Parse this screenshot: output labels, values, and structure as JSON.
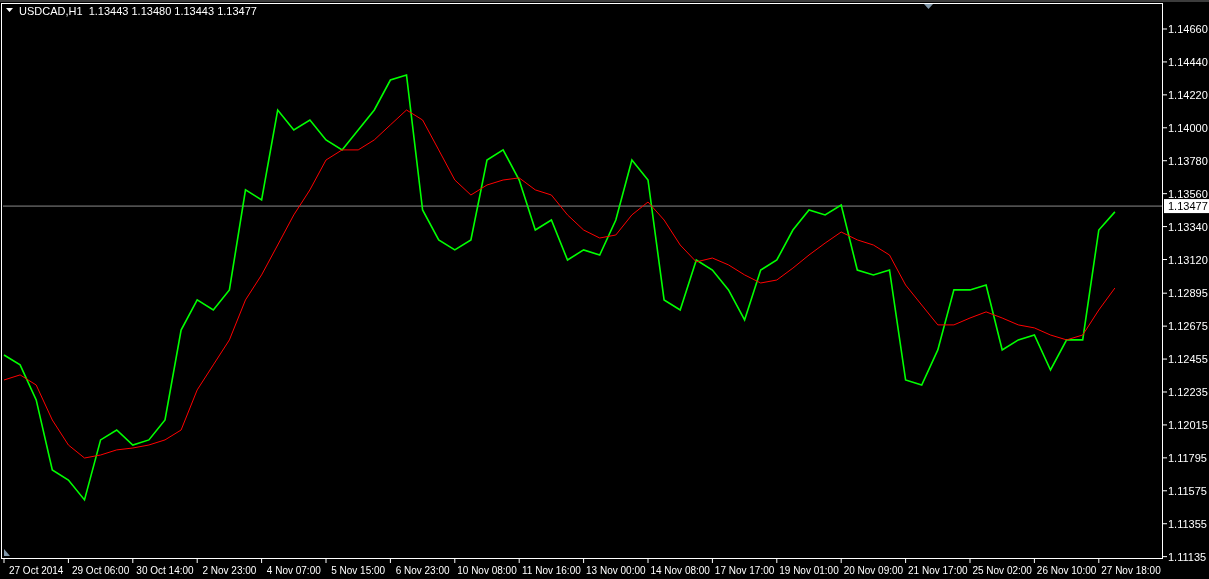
{
  "header": {
    "symbol": "USDCAD,H1",
    "quotes": [
      "1.13443",
      "1.13480",
      "1.13443",
      "1.13477"
    ]
  },
  "chart_data": {
    "type": "line",
    "categories": [
      null,
      null,
      "27 Oct 2014",
      null,
      null,
      null,
      "29 Oct 06:00",
      null,
      null,
      null,
      "30 Oct 14:00",
      null,
      null,
      null,
      "2 Nov 23:00",
      null,
      null,
      null,
      "4 Nov 07:00",
      null,
      null,
      null,
      "5 Nov 15:00",
      null,
      null,
      null,
      "6 Nov 23:00",
      null,
      null,
      null,
      "10 Nov 08:00",
      null,
      null,
      null,
      "11 Nov 16:00",
      null,
      null,
      null,
      "13 Nov 00:00",
      null,
      null,
      null,
      "14 Nov 08:00",
      null,
      null,
      null,
      "17 Nov 17:00",
      null,
      null,
      null,
      "19 Nov 01:00",
      null,
      null,
      null,
      "20 Nov 09:00",
      null,
      null,
      null,
      "21 Nov 17:00",
      null,
      null,
      null,
      "25 Nov 02:00",
      null,
      null,
      null,
      "26 Nov 10:00",
      null,
      null,
      null,
      "27 Nov 18:00"
    ],
    "series": [
      {
        "color": "#00ff00",
        "values": [
          1.12482,
          1.12416,
          1.12182,
          1.11714,
          1.11647,
          1.11514,
          1.11915,
          1.11981,
          1.11881,
          1.11915,
          1.12048,
          1.12649,
          1.1285,
          1.12783,
          1.12917,
          1.13585,
          1.13518,
          1.14119,
          1.13985,
          1.14052,
          1.13919,
          1.13852,
          1.13985,
          1.14119,
          1.14319,
          1.14353,
          1.13451,
          1.13251,
          1.13184,
          1.13251,
          1.13785,
          1.13852,
          1.13651,
          1.13317,
          1.13384,
          1.13117,
          1.13184,
          1.1315,
          1.13384,
          1.13785,
          1.13651,
          1.1285,
          1.12783,
          1.13117,
          1.1305,
          1.12917,
          1.12716,
          1.1305,
          1.13117,
          1.13317,
          1.13451,
          1.13418,
          1.13484,
          1.1305,
          1.13017,
          1.1305,
          1.12315,
          1.12282,
          1.12516,
          1.12917,
          1.12917,
          1.1295,
          1.12516,
          1.12583,
          1.12616,
          1.12382,
          1.12583,
          1.12583,
          1.13317,
          1.13438,
          null
        ]
      },
      {
        "color": "#ff0000",
        "values": [
          1.12315,
          1.12349,
          1.12282,
          1.12048,
          1.11881,
          1.11794,
          1.11814,
          1.11848,
          1.11861,
          1.11881,
          1.11915,
          1.11981,
          1.12249,
          1.12416,
          1.12583,
          1.1285,
          1.13017,
          1.13217,
          1.13418,
          1.13585,
          1.13785,
          1.13852,
          1.13852,
          1.13919,
          1.14019,
          1.14119,
          1.14052,
          1.13852,
          1.13651,
          1.13551,
          1.13618,
          1.13651,
          1.13665,
          1.13585,
          1.13551,
          1.13418,
          1.13317,
          1.13264,
          1.13284,
          1.13418,
          1.13504,
          1.13384,
          1.13217,
          1.13104,
          1.1313,
          1.13084,
          1.13017,
          1.12963,
          1.12983,
          1.13063,
          1.1315,
          1.1323,
          1.13304,
          1.13251,
          1.13217,
          1.1315,
          1.1295,
          1.12816,
          1.12683,
          1.12683,
          1.12729,
          1.1277,
          1.12729,
          1.12683,
          1.12663,
          1.12616,
          1.12583,
          1.12616,
          1.12783,
          1.1293,
          null
        ]
      }
    ],
    "ylim": [
      1.11126,
      1.14827
    ],
    "yticks": [
      {
        "value": 1.1466,
        "label": "1.14660"
      },
      {
        "value": 1.1444,
        "label": "1.14440"
      },
      {
        "value": 1.1422,
        "label": "1.14220"
      },
      {
        "value": 1.14,
        "label": "1.14000"
      },
      {
        "value": 1.1378,
        "label": "1.13780"
      },
      {
        "value": 1.1356,
        "label": "1.13560"
      },
      {
        "value": 1.1334,
        "label": "1.13340"
      },
      {
        "value": 1.1312,
        "label": "1.13120"
      },
      {
        "value": 1.12895,
        "label": "1.12895"
      },
      {
        "value": 1.12675,
        "label": "1.12675"
      },
      {
        "value": 1.12455,
        "label": "1.12455"
      },
      {
        "value": 1.12235,
        "label": "1.12235"
      },
      {
        "value": 1.12015,
        "label": "1.12015"
      },
      {
        "value": 1.11795,
        "label": "1.11795"
      },
      {
        "value": 1.11575,
        "label": "1.11575"
      },
      {
        "value": 1.11355,
        "label": "1.11355"
      },
      {
        "value": 1.11135,
        "label": "1.11135"
      }
    ],
    "ref_lines": [
      {
        "axis": "y",
        "value": 1.13477,
        "label": "1.13477"
      }
    ]
  }
}
